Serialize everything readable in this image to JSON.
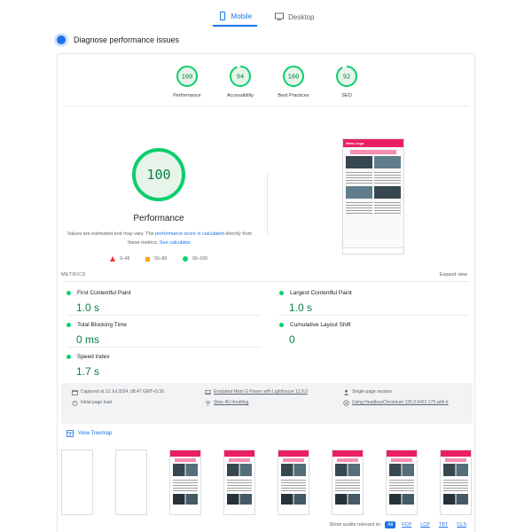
{
  "device_tabs": [
    {
      "label": "Mobile",
      "icon": "smartphone-icon",
      "active": true
    },
    {
      "label": "Desktop",
      "icon": "monitor-icon",
      "active": false
    }
  ],
  "diagnose": {
    "title": "Diagnose performance issues"
  },
  "categories": [
    {
      "score": "100",
      "label": "Performance",
      "value": 100
    },
    {
      "score": "94",
      "label": "Accessibility",
      "value": 94
    },
    {
      "score": "100",
      "label": "Best Practices",
      "value": 100
    },
    {
      "score": "92",
      "label": "SEO",
      "value": 92
    }
  ],
  "performance": {
    "score": "100",
    "value": 100,
    "title": "Performance",
    "note_prefix": "Values are estimated and may vary. The ",
    "note_link1": "performance score is calculated",
    "note_mid": " directly from these metrics. ",
    "note_link2": "See calculator.",
    "legend": [
      "0–49",
      "50–89",
      "90–100"
    ]
  },
  "preview": {
    "site_title": "West Logo"
  },
  "metrics": {
    "heading": "METRICS",
    "expand_label": "Expand view",
    "items": [
      {
        "name": "First Contentful Paint",
        "value": "1.0 s"
      },
      {
        "name": "Largest Contentful Paint",
        "value": "1.0 s"
      },
      {
        "name": "Total Blocking Time",
        "value": "0 ms"
      },
      {
        "name": "Cumulative Layout Shift",
        "value": "0"
      },
      {
        "name": "Speed Index",
        "value": "1.7 s"
      }
    ]
  },
  "run_info": {
    "captured": "Captured at 13 Jul 2024, 08:47 GMT+5:30",
    "initial_load": "Initial page load",
    "device": "Emulated Moto G Power with Lighthouse 12.0.0",
    "throttling": "Slow 4G throttling",
    "session": "Single-page session",
    "browser": "Using HeadlessChromium 125.0.6422.175 with lr"
  },
  "treemap": {
    "label": "View Treemap"
  },
  "filters": {
    "label": "Show audits relevant to:",
    "chips": [
      "All",
      "FCP",
      "LCP",
      "TBT",
      "CLS"
    ]
  },
  "colors": {
    "pass": "#0cce6b",
    "pass_text": "#0b8043",
    "accent": "#1a73e8",
    "brand": "#e91e63"
  }
}
